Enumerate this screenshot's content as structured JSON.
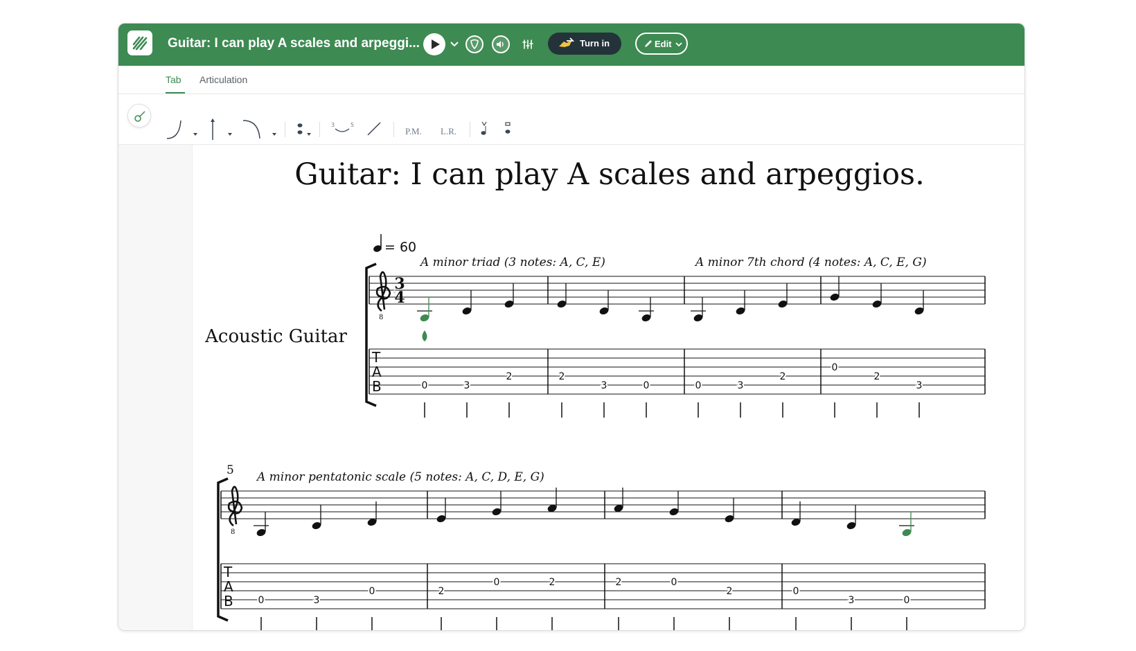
{
  "app": {
    "document_title": "Guitar: I can play A scales and arpeggi...",
    "turn_in_label": "Turn in",
    "edit_label": "Edit"
  },
  "colors": {
    "brand_green": "#3d8a52",
    "dark_button": "#24323a",
    "note_green": "#3d8a52",
    "ink": "#111111"
  },
  "icons": {
    "logo": "app-logo-icon",
    "play": "play-icon",
    "play_options": "chevron-down-icon",
    "tuner": "guitar-pick-icon",
    "volume": "speaker-icon",
    "mixer": "mixer-icon",
    "turn_in": "hand-send-icon",
    "edit": "pencil-icon",
    "guitar_tool": "guitar-icon"
  },
  "tabs": [
    {
      "label": "Tab",
      "active": true
    },
    {
      "label": "Articulation",
      "active": false
    }
  ],
  "toolbar": {
    "slur_icon": "slur-icon",
    "bend_icon": "bend-icon",
    "release_icon": "release-icon",
    "grace_icon": "grace-note-icon",
    "tie_icon": "tie-icon",
    "slide_icon": "slide-icon",
    "palm_mute_label": "P.M.",
    "let_ring_label": "L.R.",
    "strum_down_icon": "strum-down-icon",
    "strum_up_icon": "strum-up-icon",
    "tie_numbers": "3   5"
  },
  "score": {
    "title": "Guitar: I can play A scales and arpeggios.",
    "instrument": "Acoustic Guitar",
    "tempo": "= 60",
    "time_signature": [
      "3",
      "4"
    ],
    "tab_letters": [
      "T",
      "A",
      "B"
    ],
    "systems": [
      {
        "measure_number": "",
        "annotations": [
          {
            "text": "A minor triad (3 notes: A, C, E)",
            "measure": 0
          },
          {
            "text": "A minor 7th chord (4 notes: A, C, E, G)",
            "measure": 2
          }
        ],
        "measures": [
          [
            {
              "pitch": "A2",
              "string": 5,
              "fret": "0",
              "highlight": true
            },
            {
              "pitch": "C3",
              "string": 5,
              "fret": "3"
            },
            {
              "pitch": "E3",
              "string": 4,
              "fret": "2"
            }
          ],
          [
            {
              "pitch": "E3",
              "string": 4,
              "fret": "2"
            },
            {
              "pitch": "C3",
              "string": 5,
              "fret": "3"
            },
            {
              "pitch": "A2",
              "string": 5,
              "fret": "0"
            }
          ],
          [
            {
              "pitch": "A2",
              "string": 5,
              "fret": "0"
            },
            {
              "pitch": "C3",
              "string": 5,
              "fret": "3"
            },
            {
              "pitch": "E3",
              "string": 4,
              "fret": "2"
            }
          ],
          [
            {
              "pitch": "G3",
              "string": 3,
              "fret": "0"
            },
            {
              "pitch": "E3",
              "string": 4,
              "fret": "2"
            },
            {
              "pitch": "C3",
              "string": 5,
              "fret": "3"
            }
          ]
        ]
      },
      {
        "measure_number": "5",
        "annotations": [
          {
            "text": "A minor pentatonic scale (5 notes: A, C, D, E, G)",
            "measure": 0
          }
        ],
        "measures": [
          [
            {
              "pitch": "A2",
              "string": 5,
              "fret": "0"
            },
            {
              "pitch": "C3",
              "string": 5,
              "fret": "3"
            },
            {
              "pitch": "D3",
              "string": 4,
              "fret": "0"
            }
          ],
          [
            {
              "pitch": "E3",
              "string": 4,
              "fret": "2"
            },
            {
              "pitch": "G3",
              "string": 3,
              "fret": "0"
            },
            {
              "pitch": "A3",
              "string": 3,
              "fret": "2"
            }
          ],
          [
            {
              "pitch": "A3",
              "string": 3,
              "fret": "2"
            },
            {
              "pitch": "G3",
              "string": 3,
              "fret": "0"
            },
            {
              "pitch": "E3",
              "string": 4,
              "fret": "2"
            }
          ],
          [
            {
              "pitch": "D3",
              "string": 4,
              "fret": "0"
            },
            {
              "pitch": "C3",
              "string": 5,
              "fret": "3"
            },
            {
              "pitch": "A2",
              "string": 5,
              "fret": "0",
              "highlight": true
            }
          ]
        ]
      }
    ]
  }
}
